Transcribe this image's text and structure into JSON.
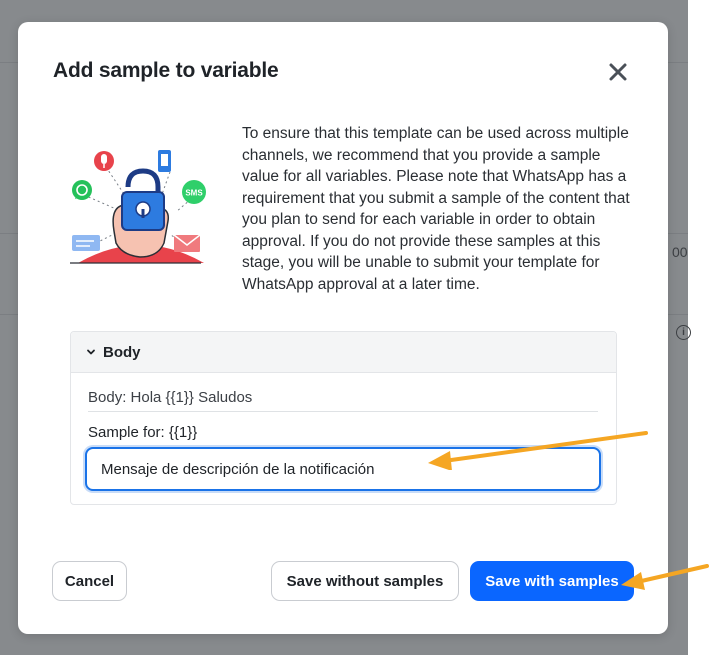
{
  "background": {
    "partial_text": "00",
    "info_icon": "info-icon"
  },
  "modal": {
    "title": "Add sample to variable",
    "close_icon": "close-icon",
    "intro_text": "To ensure that this template can be used across multiple channels, we recommend that you provide a sample value for all variables. Please note that WhatsApp has a requirement that you submit a sample of the content that you plan to send for each variable in order to obtain approval. If you do not provide these samples at this stage, you will be unable to submit your template for WhatsApp approval at a later time.",
    "illustration_icons": [
      "lock-icon",
      "hand-icon",
      "microphone-icon",
      "phone-icon",
      "whatsapp-icon",
      "sms-icon",
      "chat-icon",
      "mail-icon"
    ],
    "sms_badge": "SMS"
  },
  "section": {
    "title": "Body",
    "body_preview": "Body: Hola {{1}} Saludos",
    "sample_label": "Sample for: {{1}}",
    "sample_value": "Mensaje de descripción de la notificación"
  },
  "buttons": {
    "cancel": "Cancel",
    "save_without": "Save without samples",
    "save_with": "Save with samples"
  },
  "colors": {
    "primary": "#0a66ff",
    "focus_border": "#1a73e8",
    "annotation_arrow": "#f5a623",
    "overlay": "#878a8d"
  }
}
